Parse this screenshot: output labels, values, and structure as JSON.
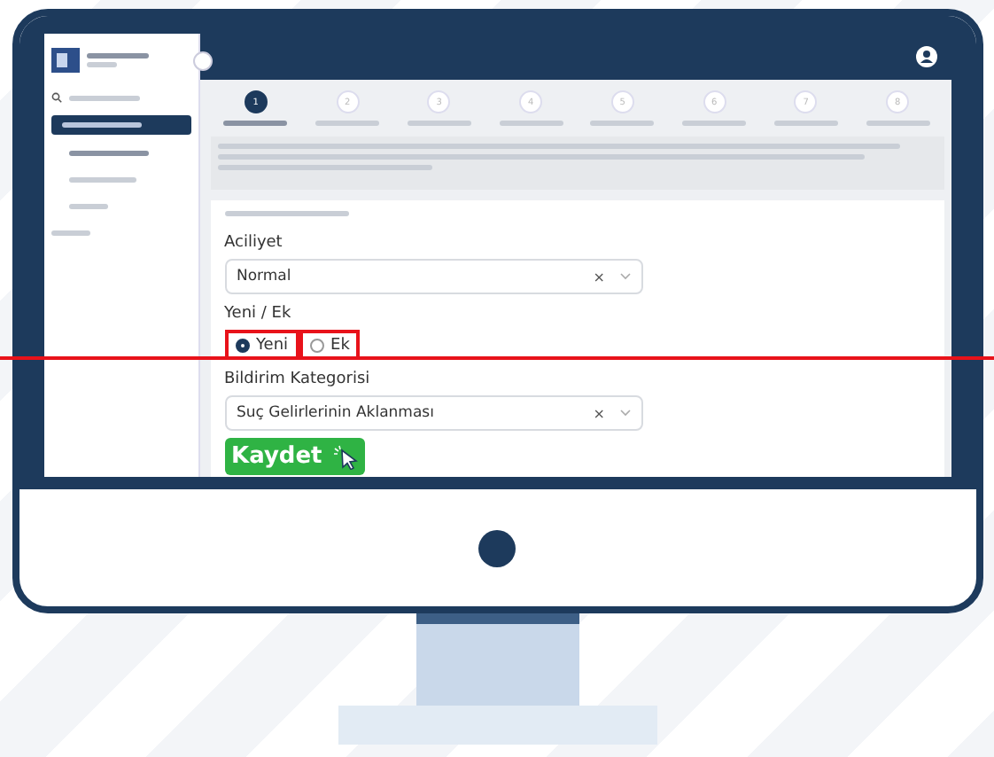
{
  "steps": [
    {
      "number": "1",
      "selected": true
    },
    {
      "number": "2",
      "selected": false
    },
    {
      "number": "3",
      "selected": false
    },
    {
      "number": "4",
      "selected": false
    },
    {
      "number": "5",
      "selected": false
    },
    {
      "number": "6",
      "selected": false
    },
    {
      "number": "7",
      "selected": false
    },
    {
      "number": "8",
      "selected": false
    }
  ],
  "form": {
    "urgency": {
      "label": "Aciliyet",
      "value": "Normal",
      "clear": "×"
    },
    "new_or_additional": {
      "label": "Yeni / Ek",
      "options": [
        {
          "label": "Yeni",
          "selected": true,
          "highlighted": true
        },
        {
          "label": "Ek",
          "selected": false,
          "highlighted": true
        }
      ]
    },
    "category": {
      "label": "Bildirim Kategorisi",
      "value": "Suç Gelirlerinin Aklanması",
      "clear": "×"
    },
    "save_button": {
      "label": "Kaydet"
    }
  }
}
